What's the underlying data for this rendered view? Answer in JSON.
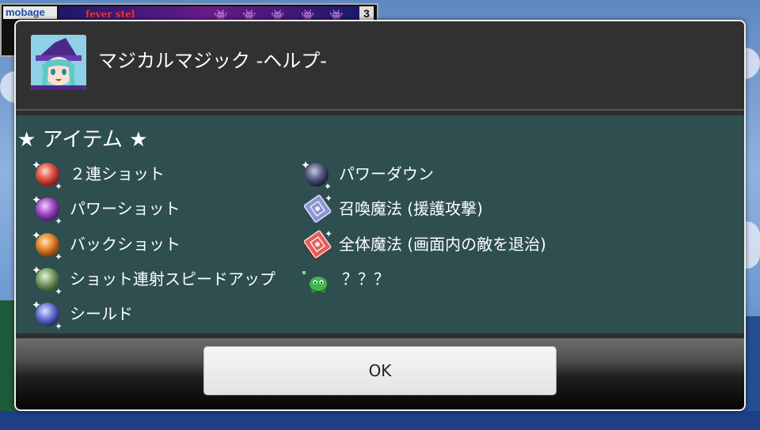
{
  "background": {
    "ad_logo": "mobage",
    "ad_text": "fever stel",
    "ad_number": "3"
  },
  "dialog": {
    "title": "マジカルマジック -ヘルプ-",
    "section_title": "★ アイテム ★",
    "items_left": [
      {
        "label": "２連ショット",
        "icon": "red-orb-icon",
        "color": "#e0584a"
      },
      {
        "label": "パワーショット",
        "icon": "purple-orb-icon",
        "color": "#a54fc8"
      },
      {
        "label": "バックショット",
        "icon": "orange-orb-icon",
        "color": "#e6892f"
      },
      {
        "label": "ショット連射スピードアップ",
        "icon": "green-orb-icon",
        "color": "#7fa36a"
      },
      {
        "label": "シールド",
        "icon": "blue-orb-icon",
        "color": "#6b79d6"
      }
    ],
    "items_right": [
      {
        "label": "パワーダウン",
        "icon": "dark-orb-icon",
        "color": "#5a5f86"
      },
      {
        "label": "召喚魔法 (援護攻撃)",
        "icon": "blue-spellbook-icon",
        "color": "#6f7bb3"
      },
      {
        "label": "全体魔法 (画面内の敵を退治)",
        "icon": "red-spellbook-icon",
        "color": "#d9504a"
      },
      {
        "label": "？？？",
        "icon": "green-creature-icon",
        "color": "#3fb84a"
      }
    ],
    "ok_label": "OK"
  }
}
